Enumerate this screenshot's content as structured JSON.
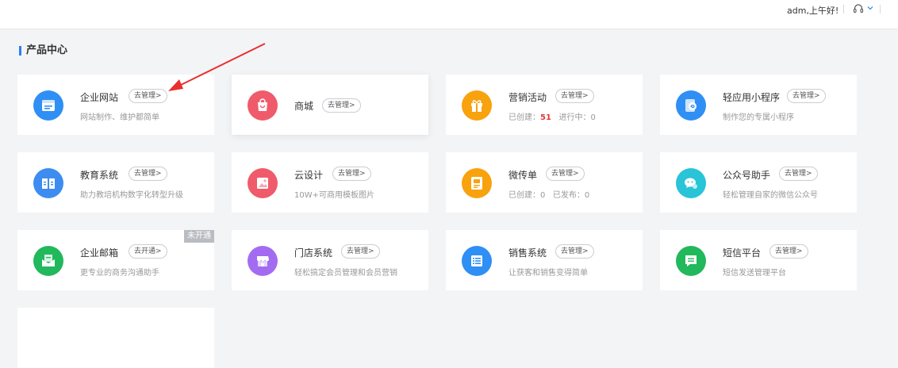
{
  "header": {
    "greeting": "adm,上午好!"
  },
  "section": {
    "title": "产品中心"
  },
  "colors": {
    "accent": "#2b7ff5",
    "annotation_arrow": "#e8312f",
    "badge_bg": "#b9bcc1"
  },
  "products": [
    {
      "name": "企业网站",
      "button": "去管理>",
      "desc": "网站制作、维护都简单",
      "icon": "website-icon",
      "color": "#2f8ff4"
    },
    {
      "name": "商城",
      "button": "去管理>",
      "desc": "",
      "icon": "shopping-bag-icon",
      "color": "#ef5b6b"
    },
    {
      "name": "营销活动",
      "button": "去管理>",
      "icon": "gift-icon",
      "color": "#f8a20e",
      "stats": {
        "created_label": "已创建：",
        "created_value": "51",
        "running_label": "进行中：",
        "running_value": "0"
      }
    },
    {
      "name": "轻应用小程序",
      "button": "去管理>",
      "desc": "制作您的专属小程序",
      "icon": "mini-program-icon",
      "color": "#2f8ff4"
    },
    {
      "name": "教育系统",
      "button": "去管理>",
      "desc": "助力教培机构数字化转型升级",
      "icon": "book-icon",
      "color": "#3d8cf0"
    },
    {
      "name": "云设计",
      "button": "去管理>",
      "desc": "10W+可商用模板图片",
      "icon": "image-icon",
      "color": "#ef5b6b"
    },
    {
      "name": "微传单",
      "button": "去管理>",
      "icon": "flyer-icon",
      "color": "#f8a20e",
      "stats": {
        "created_label": "已创建：",
        "created_value": "0",
        "published_label": "已发布：",
        "published_value": "0"
      }
    },
    {
      "name": "公众号助手",
      "button": "去管理>",
      "desc": "轻松管理自家的微信公众号",
      "icon": "wechat-icon",
      "color": "#29c4d8"
    },
    {
      "name": "企业邮箱",
      "button": "去开通>",
      "desc": "更专业的商务沟通助手",
      "icon": "mail-icon",
      "color": "#22b85c",
      "badge": "未开通"
    },
    {
      "name": "门店系统",
      "button": "去管理>",
      "desc": "轻松搞定会员管理和会员营销",
      "icon": "store-icon",
      "color": "#a36cf0"
    },
    {
      "name": "销售系统",
      "button": "去管理>",
      "desc": "让获客和销售变得简单",
      "icon": "list-icon",
      "color": "#2f8ff4"
    },
    {
      "name": "短信平台",
      "button": "去管理>",
      "desc": "短信发送管理平台",
      "icon": "message-icon",
      "color": "#22b85c"
    }
  ]
}
